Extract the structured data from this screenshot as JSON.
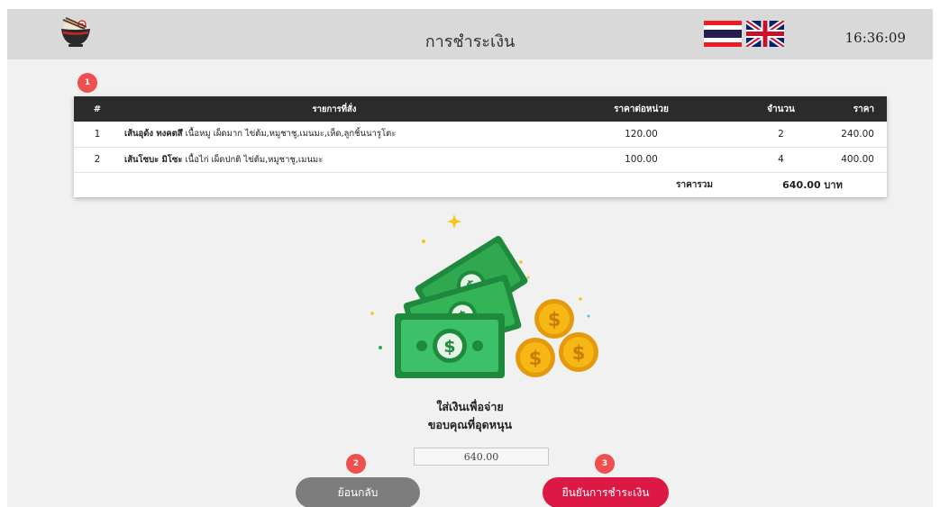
{
  "header": {
    "title": "การชำระเงิน",
    "time": "16:36:09",
    "flags": [
      "thai-flag",
      "uk-flag"
    ]
  },
  "badges": [
    "1",
    "2",
    "3"
  ],
  "order_table": {
    "columns": [
      "#",
      "รายการที่สั่ง",
      "ราคาต่อหน่วย",
      "จำนวน",
      "ราคา"
    ],
    "rows": [
      {
        "num": "1",
        "name": "เส้นอุด้ง ทงคตสึ",
        "details": "เนื้อหมู เผ็ดมาก ไข่ต้ม,หมูชาชู,เมนมะ,เห็ด,ลูกชิ้นนารูโตะ",
        "unit_price": "120.00",
        "qty": "2",
        "price": "240.00"
      },
      {
        "num": "2",
        "name": "เส้นโซบะ มิโซะ",
        "details": "เนื้อไก่ เผ็ดปกติ ไข่ต้ม,หมูชาชู,เมนมะ",
        "unit_price": "100.00",
        "qty": "4",
        "price": "400.00"
      }
    ],
    "total_label": "ราคารวม",
    "total_value": "640.00 บาท"
  },
  "message": {
    "line1": "ใส่เงินเพื่อจ่าย",
    "line2": "ขอบคุณที่อุดหนุน"
  },
  "amount_input": {
    "value": "640.00"
  },
  "buttons": {
    "back": "ย้อนกลับ",
    "confirm": "ยืนยันการชำระเงิน"
  },
  "colors": {
    "header_bg": "#d9d9d9",
    "table_header_bg": "#2b2b2b",
    "badge": "#ef4f4f",
    "back_button": "#7d7d7d",
    "confirm_button": "#dc1844",
    "money_green": "#2fa84f",
    "coin_gold": "#f5b814"
  }
}
